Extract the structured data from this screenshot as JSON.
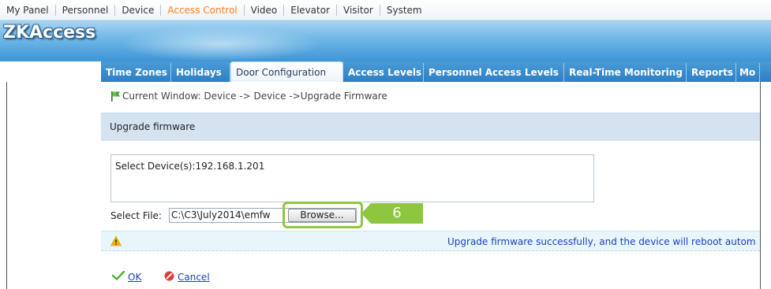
{
  "top_menu": [
    {
      "label": "My Panel",
      "active": false
    },
    {
      "label": "Personnel",
      "active": false
    },
    {
      "label": "Device",
      "active": false
    },
    {
      "label": "Access Control",
      "active": true
    },
    {
      "label": "Video",
      "active": false
    },
    {
      "label": "Elevator",
      "active": false
    },
    {
      "label": "Visitor",
      "active": false
    },
    {
      "label": "System",
      "active": false
    }
  ],
  "brand": {
    "logo_text": "ZKAccess"
  },
  "tabs": [
    {
      "label": "Time Zones",
      "active": false
    },
    {
      "label": "Holidays",
      "active": false
    },
    {
      "label": "Door Configuration",
      "active": true
    },
    {
      "label": "Access Levels",
      "active": false
    },
    {
      "label": "Personnel Access Levels",
      "active": false
    },
    {
      "label": "Real-Time Monitoring",
      "active": false
    },
    {
      "label": "Reports",
      "active": false
    },
    {
      "label": "Mo",
      "active": false
    }
  ],
  "breadcrumb": {
    "text": "Current Window: Device -> Device ->Upgrade Firmware"
  },
  "panel": {
    "title": "Upgrade firmware"
  },
  "device": {
    "text": "Select Device(s):192.168.1.201"
  },
  "file": {
    "label": "Select File:",
    "value": "C:\\C3\\July2014\\emfw",
    "browse_label": "Browse..."
  },
  "step": {
    "number": "6"
  },
  "status": {
    "message": "Upgrade firmware successfully, and the device will reboot autom"
  },
  "actions": {
    "ok_label": "OK",
    "cancel_label": "Cancel"
  },
  "colors": {
    "accent": "#ff7f1c",
    "highlight": "#8dc63f",
    "link": "#1b3fbf",
    "tabbar": "#2c7fc4"
  }
}
